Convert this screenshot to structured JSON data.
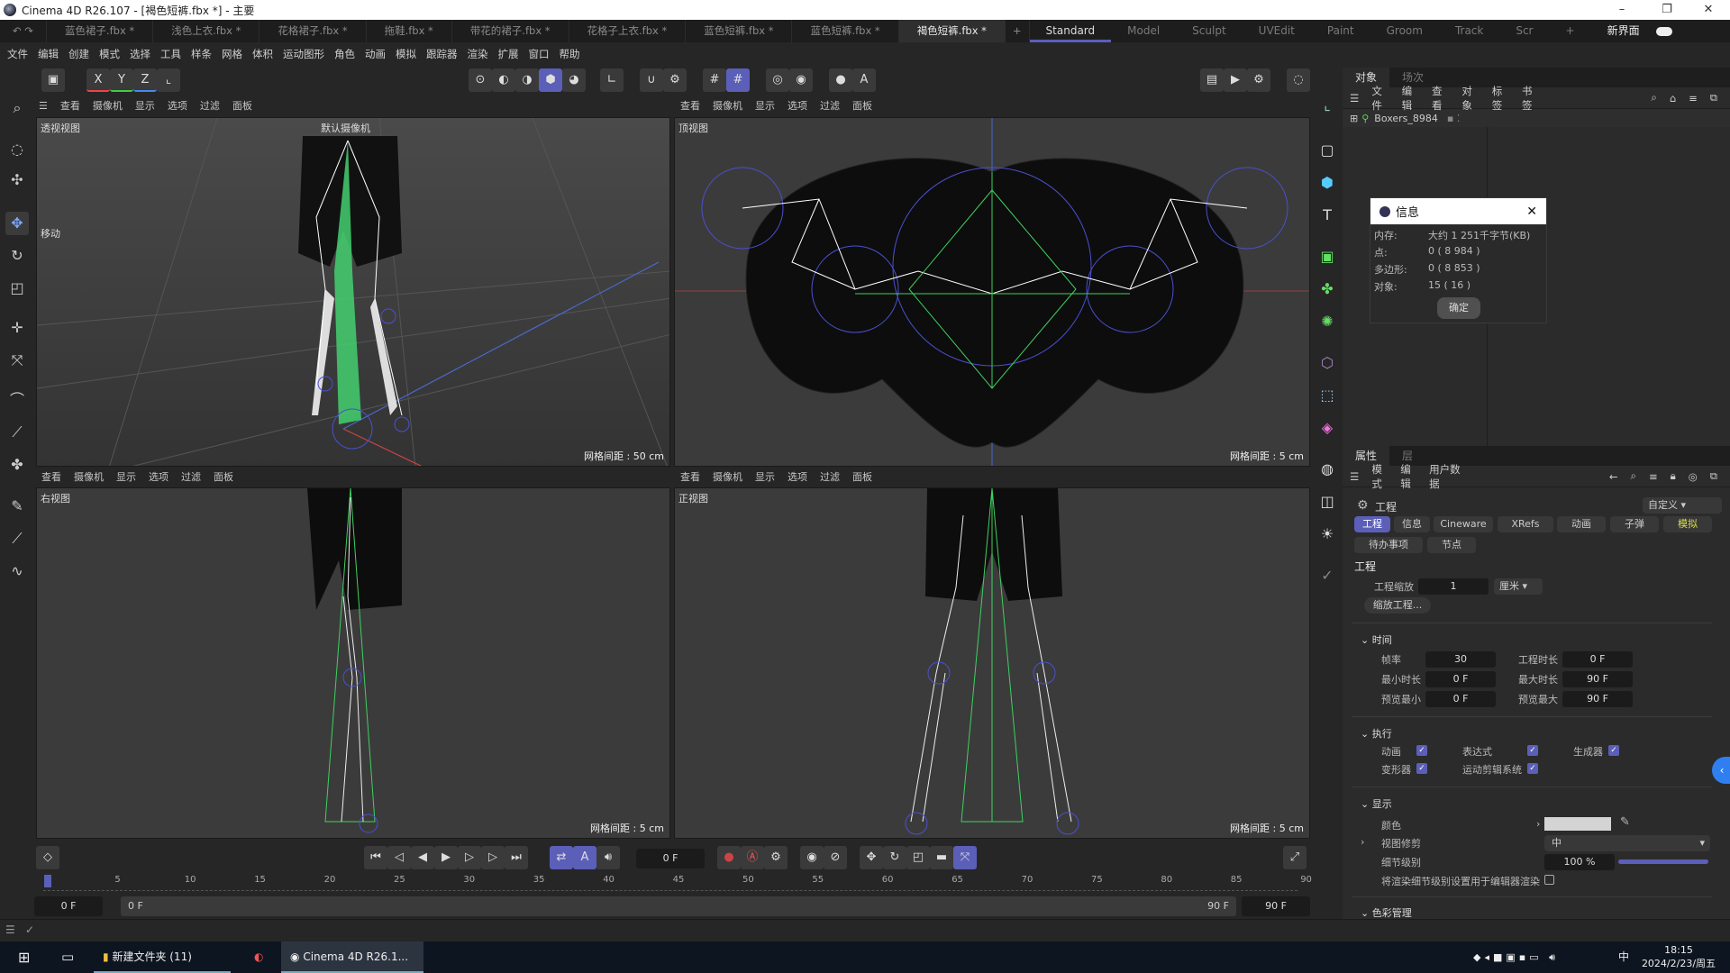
{
  "window": {
    "title": "Cinema 4D R26.107 - [褐色短裤.fbx *] - 主要",
    "minimize": "–",
    "maximize": "❐",
    "close": "✕"
  },
  "doc_tabs": [
    "蓝色裙子.fbx *",
    "浅色上衣.fbx *",
    "花格裙子.fbx *",
    "拖鞋.fbx *",
    "带花的裙子.fbx *",
    "花格子上衣.fbx *",
    "蓝色短裤.fbx *",
    "蓝色短裤.fbx *",
    "褐色短裤.fbx *"
  ],
  "active_doc_tab": "褐色短裤.fbx *",
  "layout_tabs": [
    "Standard",
    "Model",
    "Sculpt",
    "UVEdit",
    "Paint",
    "Groom",
    "Track",
    "Scr"
  ],
  "new_ui_label": "新界面",
  "menu": [
    "文件",
    "编辑",
    "创建",
    "模式",
    "选择",
    "工具",
    "样条",
    "网格",
    "体积",
    "运动图形",
    "角色",
    "动画",
    "模拟",
    "跟踪器",
    "渲染",
    "扩展",
    "窗口",
    "帮助"
  ],
  "axis_buttons": [
    "X",
    "Y",
    "Z"
  ],
  "viewport_menu": [
    "查看",
    "摄像机",
    "显示",
    "选项",
    "过滤",
    "面板"
  ],
  "viewports": [
    {
      "name": "透视视图",
      "camera": "默认摄像机",
      "grid": "网格间距 : 50 cm",
      "move_label": "移动"
    },
    {
      "name": "顶视图",
      "grid": "网格间距 : 5 cm"
    },
    {
      "name": "右视图",
      "grid": "网格间距 : 5 cm"
    },
    {
      "name": "正视图",
      "grid": "网格间距 : 5 cm"
    }
  ],
  "object_manager": {
    "tabs": [
      "对象",
      "场次"
    ],
    "menu": [
      "文件",
      "编辑",
      "查看",
      "对象",
      "标签",
      "书签"
    ],
    "object": "Boxers_8984"
  },
  "info_dialog": {
    "title": "信息",
    "rows": [
      {
        "label": "内存:",
        "value": "大约 1 251千字节(KB)"
      },
      {
        "label": "点:",
        "value": "0 ( 8 984 )"
      },
      {
        "label": "多边形:",
        "value": "0 ( 8 853 )"
      },
      {
        "label": "对象:",
        "value": "15 ( 16 )"
      }
    ],
    "ok": "确定"
  },
  "attributes": {
    "tabs": [
      "属性",
      "层"
    ],
    "menu": [
      "模式",
      "编辑",
      "用户数据"
    ],
    "title": "工程",
    "preset": "自定义",
    "chips": [
      "工程",
      "信息",
      "Cineware",
      "XRefs",
      "动画",
      "子弹",
      "模拟",
      "待办事项",
      "节点"
    ],
    "section_title": "工程",
    "scale_label": "工程缩放",
    "scale_value": "1",
    "unit": "厘米",
    "scale_button": "缩放工程...",
    "time": {
      "title": "时间",
      "fps_label": "帧率",
      "fps": "30",
      "proj_len_label": "工程时长",
      "proj_len": "0 F",
      "min_label": "最小时长",
      "min": "0 F",
      "max_label": "最大时长",
      "max": "90 F",
      "pmin_label": "预览最小",
      "pmin": "0 F",
      "pmax_label": "预览最大",
      "pmax": "90 F"
    },
    "exec": {
      "title": "执行",
      "animation": "动画",
      "expression": "表达式",
      "generator": "生成器",
      "deformer": "变形器",
      "motion": "运动剪辑系统"
    },
    "display": {
      "title": "显示",
      "color": "颜色",
      "clip": "视图修剪",
      "clip_value": "中",
      "lod": "细节级别",
      "lod_value": "100 %",
      "lod_fraction": 1.0,
      "render_lod": "将渲染细节级别设置用于编辑器渲染"
    },
    "color_mgmt": "色彩管理"
  },
  "timeline": {
    "current_frame": "0 F",
    "ticks": [
      "0",
      "5",
      "10",
      "15",
      "20",
      "25",
      "30",
      "35",
      "40",
      "45",
      "50",
      "55",
      "60",
      "65",
      "70",
      "75",
      "80",
      "85",
      "90"
    ],
    "start": "0 F",
    "range_start": "0 F",
    "range_end": "90 F",
    "end": "90 F"
  },
  "taskbar": {
    "folder": "新建文件夹 (11)",
    "app": "Cinema 4D R26.1...",
    "time": "18:15",
    "date": "2024/2/23/周五",
    "ime": "中"
  },
  "colors": {
    "accent": "#5b5fb8",
    "bone": "#38d060",
    "viewport_bg": "#3b3b3b"
  }
}
